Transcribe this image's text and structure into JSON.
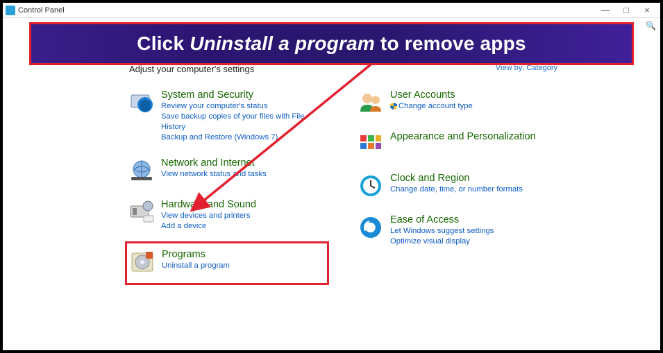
{
  "window": {
    "title": "Control Panel"
  },
  "banner": {
    "prefix": "Click ",
    "italic": "Uninstall a program",
    "suffix": " to remove apps"
  },
  "heading": "Adjust your computer's settings",
  "viewby": "View by:  Category",
  "left": [
    {
      "title": "System and Security",
      "links": [
        "Review your computer's status",
        "Save backup copies of your files with File History",
        "Backup and Restore (Windows 7)"
      ]
    },
    {
      "title": "Network and Internet",
      "links": [
        "View network status and tasks"
      ]
    },
    {
      "title": "Hardware and Sound",
      "links": [
        "View devices and printers",
        "Add a device"
      ]
    },
    {
      "title": "Programs",
      "links": [
        "Uninstall a program"
      ]
    }
  ],
  "right": [
    {
      "title": "User Accounts",
      "links": [
        "Change account type"
      ],
      "shield": true
    },
    {
      "title": "Appearance and Personalization",
      "links": []
    },
    {
      "title": "Clock and Region",
      "links": [
        "Change date, time, or number formats"
      ]
    },
    {
      "title": "Ease of Access",
      "links": [
        "Let Windows suggest settings",
        "Optimize visual display"
      ]
    }
  ]
}
